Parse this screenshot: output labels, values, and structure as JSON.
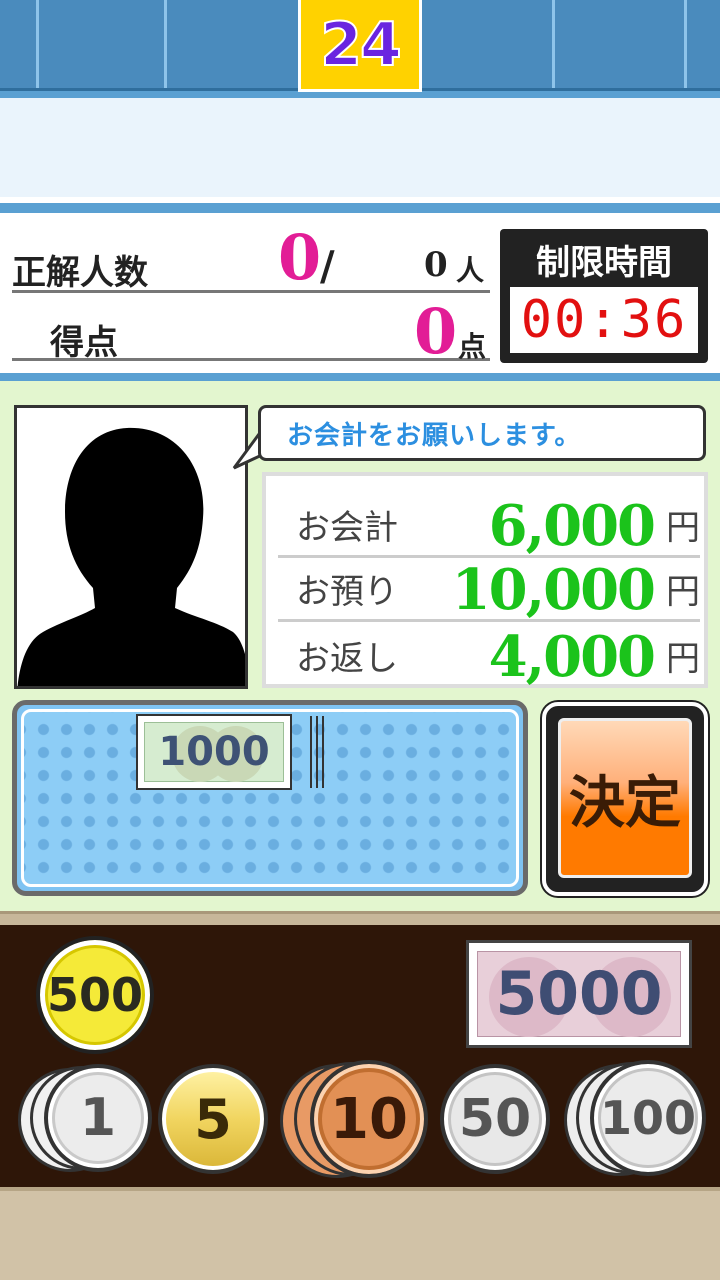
{
  "round": "24",
  "score": {
    "correct_label": "正解人数",
    "correct_count": "0",
    "slash": "/",
    "total_count": "0",
    "person_unit": "人",
    "points_label": "得点",
    "points_value": "0",
    "points_unit": "点"
  },
  "timer": {
    "label": "制限時間",
    "value": "00:36"
  },
  "customer": {
    "speech": "お会計をお願いします。"
  },
  "bill": {
    "rows": [
      {
        "label": "お会計",
        "value": "6,000",
        "unit": "円"
      },
      {
        "label": "お預り",
        "value": "10,000",
        "unit": "円"
      },
      {
        "label": "お返し",
        "value": "4,000",
        "unit": "円"
      }
    ]
  },
  "tray": {
    "note_label": "1000"
  },
  "decide_button": "決定",
  "wallet": {
    "coin_500": "500",
    "note_5000": "5000",
    "coin_1": "1",
    "coin_5": "5",
    "coin_10": "10",
    "coin_50": "50",
    "coin_100": "100"
  },
  "colors": {
    "accent_blue": "#4a8bbd",
    "count_pink": "#e21d96",
    "money_green": "#1bc31b",
    "timer_red": "#e21010",
    "decide_orange": "#ff7a00"
  }
}
